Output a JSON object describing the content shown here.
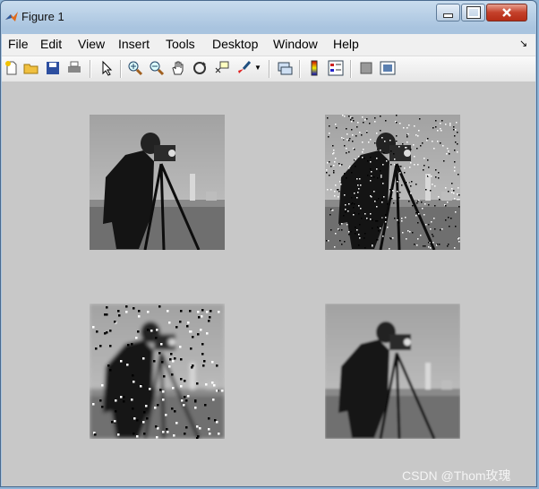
{
  "window": {
    "title": "Figure 1"
  },
  "menu": [
    "File",
    "Edit",
    "View",
    "Insert",
    "Tools",
    "Desktop",
    "Window",
    "Help"
  ],
  "toolbar": {
    "icons": [
      "new-figure-icon",
      "open-file-icon",
      "save-icon",
      "print-icon",
      "edit-plot-arrow-icon",
      "zoom-in-icon",
      "zoom-out-icon",
      "pan-hand-icon",
      "rotate-3d-icon",
      "data-cursor-icon",
      "brush-icon",
      "brush-dropdown-icon",
      "link-plot-icon",
      "colorbar-icon",
      "legend-icon",
      "hide-plot-tools-icon",
      "show-plot-tools-icon"
    ]
  },
  "images": [
    {
      "variant": "original"
    },
    {
      "variant": "salt-and-pepper-noise"
    },
    {
      "variant": "blurred-noisy"
    },
    {
      "variant": "smoothed"
    }
  ],
  "watermark": "CSDN @Thom玫瑰"
}
